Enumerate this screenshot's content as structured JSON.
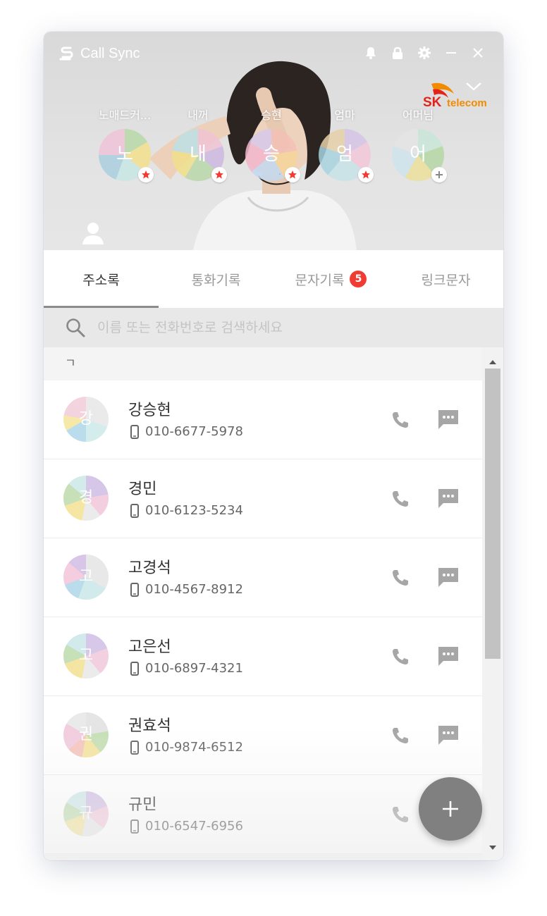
{
  "app": {
    "title": "Call Sync"
  },
  "carrier": {
    "sk": "SK",
    "telecom": "telecom"
  },
  "favorites": [
    {
      "label": "노매드커...",
      "initial": "노",
      "badge": "star"
    },
    {
      "label": "내꺼",
      "initial": "내",
      "badge": "star"
    },
    {
      "label": "승현",
      "initial": "승",
      "badge": "star"
    },
    {
      "label": "엄마",
      "initial": "엄",
      "badge": "star"
    },
    {
      "label": "어머님",
      "initial": "어",
      "badge": "plus"
    }
  ],
  "tabs": [
    {
      "label": "주소록",
      "active": true
    },
    {
      "label": "통화기록"
    },
    {
      "label": "문자기록",
      "badge": "5"
    },
    {
      "label": "링크문자"
    }
  ],
  "search": {
    "placeholder": "이름 또는 전화번호로 검색하세요"
  },
  "section": {
    "header": "ㄱ"
  },
  "contacts": [
    {
      "name": "강승현",
      "initial": "강",
      "phone": "010-6677-5978"
    },
    {
      "name": "경민",
      "initial": "경",
      "phone": "010-6123-5234"
    },
    {
      "name": "고경석",
      "initial": "고",
      "phone": "010-4567-8912"
    },
    {
      "name": "고은선",
      "initial": "고",
      "phone": "010-6897-4321"
    },
    {
      "name": "권효석",
      "initial": "권",
      "phone": "010-9874-6512"
    },
    {
      "name": "규민",
      "initial": "규",
      "phone": "010-6547-6956"
    }
  ],
  "icons": {
    "title_bar": [
      "bell-icon",
      "lock-icon",
      "gear-icon",
      "minimize-icon",
      "close-icon"
    ],
    "row_actions": [
      "phone-icon",
      "message-icon"
    ],
    "fab": "plus-icon"
  },
  "colors": {
    "badge_red": "#f03c32",
    "sk_red": "#e2231a",
    "sk_orange": "#f28b00",
    "fab_gray": "#808080"
  }
}
